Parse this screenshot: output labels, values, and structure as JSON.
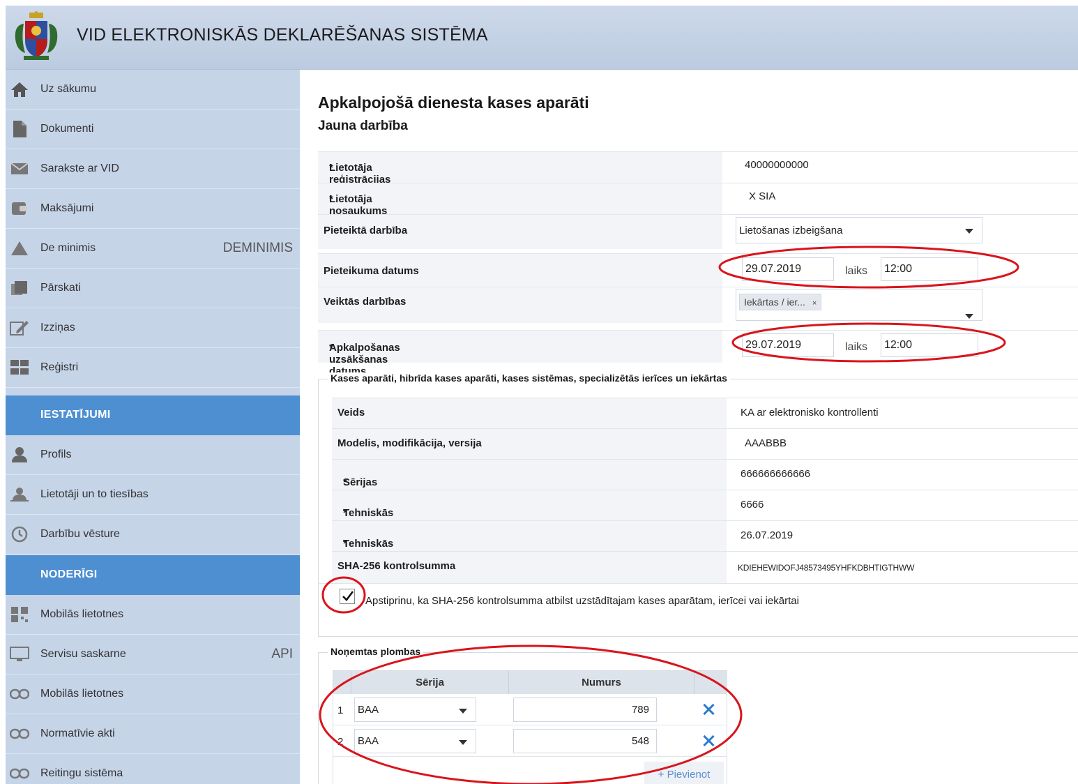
{
  "header": {
    "title": "VID ELEKTRONISKĀS DEKLARĒŠANAS SISTĒMA"
  },
  "sidebar": {
    "items": [
      {
        "label": "Uz sākumu",
        "icon": "home-icon"
      },
      {
        "label": "Dokumenti",
        "icon": "document-icon"
      },
      {
        "label": "Sarakste ar VID",
        "icon": "envelope-icon"
      },
      {
        "label": "Maksājumi",
        "icon": "payment-icon"
      },
      {
        "label": "De minimis",
        "icon": "warning-icon",
        "badge": "DEMINIMIS"
      },
      {
        "label": "Pārskati",
        "icon": "reports-icon"
      },
      {
        "label": "Izziņas",
        "icon": "edit-icon"
      },
      {
        "label": "Reģistri",
        "icon": "grid-icon"
      }
    ],
    "section_settings": "IESTATĪJUMI",
    "settings_items": [
      {
        "label": "Profils",
        "icon": "user-icon"
      },
      {
        "label": "Lietotāji un to tiesības",
        "icon": "users-icon"
      },
      {
        "label": "Darbību vēsture",
        "icon": "history-icon"
      }
    ],
    "section_useful": "NODERĪGI",
    "useful_items": [
      {
        "label": "Mobilās lietotnes",
        "icon": "qr-icon"
      },
      {
        "label": "Servisu saskarne",
        "icon": "api-icon",
        "badge": "API"
      },
      {
        "label": "Mobilās lietotnes",
        "icon": "link-icon"
      },
      {
        "label": "Normatīvie akti",
        "icon": "link-icon"
      },
      {
        "label": "Reitingu sistēma",
        "icon": "link-icon"
      }
    ]
  },
  "main": {
    "title": "Apkalpojošā dienesta kases aparāti",
    "subtitle": "Jauna darbība",
    "fields": {
      "reg_number_label": "Lietotāja reģistrācijas numurs",
      "reg_number_value": "40000000000",
      "name_label": "Lietotāja nosaukums",
      "name_value": "X SIA",
      "action_label": "Pieteiktā darbība",
      "action_value": "Lietošanas izbeigšana",
      "application_date_label": "Pieteikuma datums",
      "application_date_value": "29.07.2019",
      "time_label": "laiks",
      "application_time_value": "12:00",
      "performed_label": "Veiktās darbības",
      "performed_tag": "Iekārtas / ier...",
      "service_start_label": "Apkalpošanas uzsākšanas datums",
      "service_start_date_value": "29.07.2019",
      "service_start_time_value": "12:00",
      "required_mark": "*"
    },
    "devices": {
      "legend": "Kases aparāti, hibrīda kases aparāti, kases sistēmas, specializētās ierīces un iekārtas",
      "rows": [
        {
          "label": "Veids",
          "value": "KA ar elektronisko kontrollenti",
          "required": false
        },
        {
          "label": "Modelis, modifikācija, versija",
          "value": "AAABBB",
          "required": false
        },
        {
          "label": "Sērijas numurs",
          "value": "666666666666",
          "required": true
        },
        {
          "label": "Tehniskās pases numurs",
          "value": "6666",
          "required": true
        },
        {
          "label": "Tehniskās pases izsniegšanas datums",
          "value": "26.07.2019",
          "required": true
        },
        {
          "label": "SHA-256 kontrolsumma",
          "value": "KDIEHEWIDOFJ48573495YHFKDBHTIGTHWW",
          "required": false
        }
      ],
      "confirm_label": "Apstiprinu, ka SHA-256 kontrolsumma atbilst uzstādītajam kases aparātam, ierīcei vai iekārtai",
      "confirm_checked": true
    },
    "seals": {
      "legend": "Noņemtas plombas",
      "col_series": "Sērija",
      "col_number": "Numurs",
      "rows": [
        {
          "index": "1",
          "series": "BAA",
          "number": "789"
        },
        {
          "index": "2",
          "series": "BAA",
          "number": "548"
        }
      ],
      "add_label": "+ Pievienot"
    }
  },
  "colors": {
    "header_bg": "#c6d4e8",
    "sidebar_bg": "#c6d4e8",
    "section_bg": "#4d8fd1",
    "annotation_red": "#d9141b",
    "delete_blue": "#2a7bd0"
  }
}
